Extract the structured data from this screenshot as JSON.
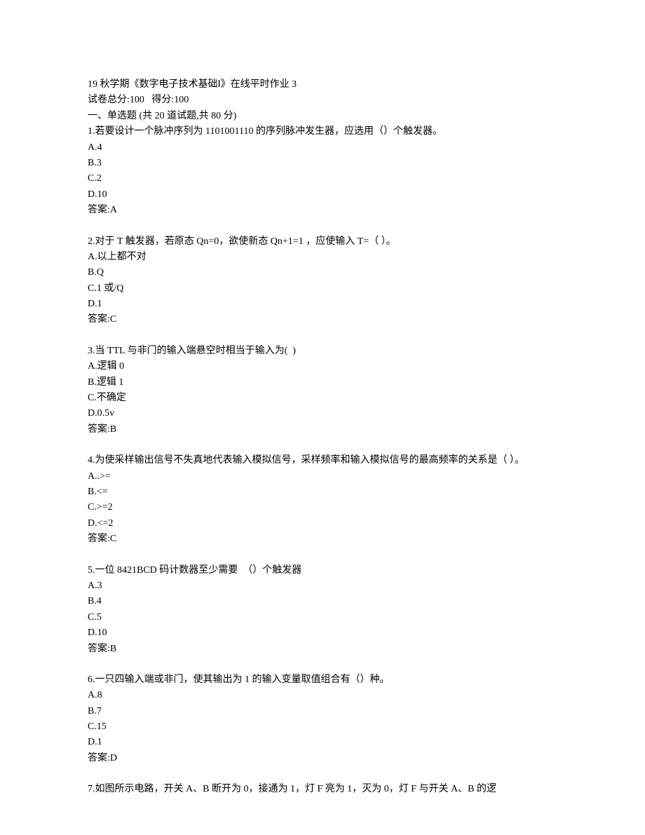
{
  "header": {
    "title": "19 秋学期《数字电子技术基础Ⅰ》在线平时作业 3",
    "score_line": "试卷总分:100   得分:100",
    "section_title": "一、单选题 (共 20 道试题,共 80 分)"
  },
  "questions": [
    {
      "stem": "1.若要设计一个脉冲序列为 1101001110 的序列脉冲发生器，应选用（）个触发器。",
      "options": [
        "A.4",
        "B.3",
        "C.2",
        "D.10"
      ],
      "answer": "答案:A"
    },
    {
      "stem": "2.对于 T 触发器，若原态 Qn=0，欲使新态 Qn+1=1 ，应使输入 T=（ ）。",
      "options": [
        "A.以上都不对",
        "B.Q",
        "C.1 或/Q",
        "D.1"
      ],
      "answer": "答案:C"
    },
    {
      "stem": "3.当 TTL 与非门的输入端悬空时相当于输入为(  )",
      "options": [
        "A.逻辑 0",
        "B.逻辑 1",
        "C.不确定",
        "D.0.5v"
      ],
      "answer": "答案:B"
    },
    {
      "stem": "4.为使采样输出信号不失真地代表输入模拟信号，采样频率和输入模拟信号的最高频率的关系是（ ）。",
      "options": [
        "A..>=",
        "B.<=",
        "C.>=2",
        "D.<=2"
      ],
      "answer": "答案:C"
    },
    {
      "stem": "5.一位 8421BCD 码计数器至少需要  （）个触发器",
      "options": [
        "A.3",
        "B.4",
        "C.5",
        "D.10"
      ],
      "answer": "答案:B"
    },
    {
      "stem": "6.一只四输入端或非门，使其输出为 1 的输入变量取值组合有（）种。",
      "options": [
        "A.8",
        "B.7",
        "C.15",
        "D.1"
      ],
      "answer": "答案:D"
    },
    {
      "stem": "7.如图所示电路，开关 A、B 断开为 0，接通为 1，灯 F 亮为 1，灭为 0，灯 F 与开关 A、B 的逻",
      "options": [],
      "answer": ""
    }
  ]
}
